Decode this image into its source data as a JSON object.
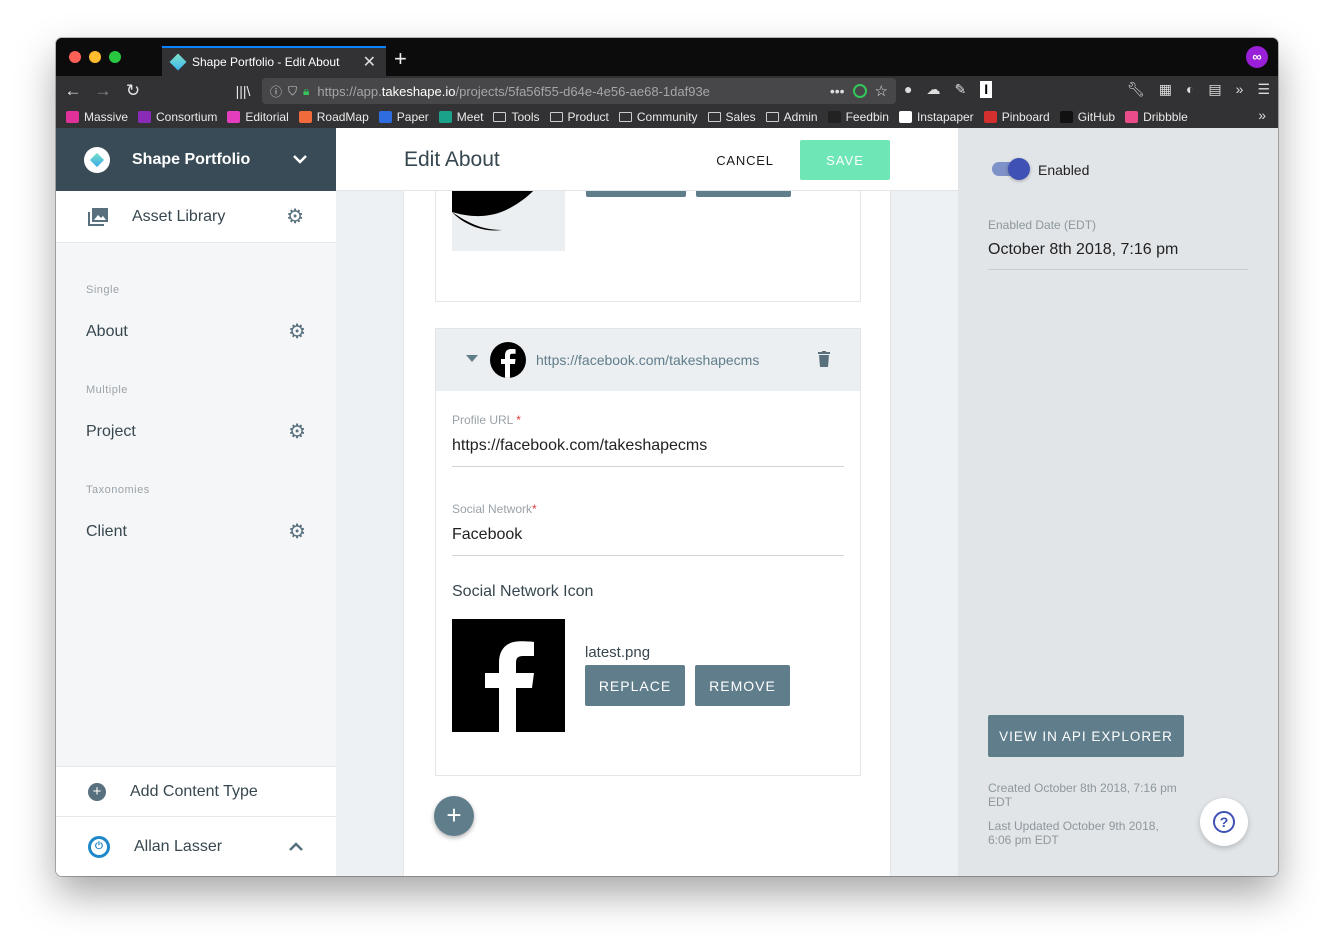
{
  "browser": {
    "tab_title": "Shape Portfolio - Edit About",
    "url_prefix": "https://app.",
    "url_domain": "takeshape.io",
    "url_path": "/projects/5fa56f55-d64e-4e56-ae68-1daf93e"
  },
  "bookmarks": [
    {
      "label": "Massive",
      "icon_color": "#e0309a"
    },
    {
      "label": "Consortium",
      "icon_color": "#8a2bb8"
    },
    {
      "label": "Editorial",
      "icon_color": "#e43dbd"
    },
    {
      "label": "RoadMap",
      "icon_color": "#f06a3b"
    },
    {
      "label": "Paper",
      "icon_color": "#2d6de0"
    },
    {
      "label": "Meet",
      "icon_color": "#1aa38a"
    },
    {
      "label": "Tools",
      "icon_color": "folder"
    },
    {
      "label": "Product",
      "icon_color": "folder"
    },
    {
      "label": "Community",
      "icon_color": "folder"
    },
    {
      "label": "Sales",
      "icon_color": "folder"
    },
    {
      "label": "Admin",
      "icon_color": "folder"
    },
    {
      "label": "Feedbin",
      "icon_color": "#222222"
    },
    {
      "label": "Instapaper",
      "icon_color": "#ffffff"
    },
    {
      "label": "Pinboard",
      "icon_color": "#d32f2f"
    },
    {
      "label": "GitHub",
      "icon_color": "#111111"
    },
    {
      "label": "Dribbble",
      "icon_color": "#ea4c89"
    }
  ],
  "sidebar": {
    "project_name": "Shape Portfolio",
    "asset_library": "Asset Library",
    "sections": {
      "single_label": "Single",
      "single_item": "About",
      "multiple_label": "Multiple",
      "multiple_item": "Project",
      "taxonomies_label": "Taxonomies",
      "taxonomies_item": "Client"
    },
    "add_content_type": "Add Content Type",
    "user_name": "Allan Lasser"
  },
  "main": {
    "title": "Edit About",
    "cancel_label": "CANCEL",
    "save_label": "SAVE",
    "replace_label": "REPLACE",
    "remove_label": "REMOVE",
    "facebook_card": {
      "header_url": "https://facebook.com/takeshapecms",
      "profile_url_label": "Profile URL",
      "profile_url_value": "https://facebook.com/takeshapecms",
      "social_network_label": "Social Network",
      "social_network_value": "Facebook",
      "icon_section_title": "Social Network Icon",
      "icon_filename": "latest.png",
      "required_mark": "*"
    }
  },
  "right_panel": {
    "enabled_label": "Enabled",
    "enabled": true,
    "enabled_date_label": "Enabled Date (EDT)",
    "enabled_date_value": "October 8th 2018, 7:16 pm",
    "api_explorer_label": "VIEW IN API EXPLORER",
    "created_text": "Created October 8th 2018, 7:16 pm EDT",
    "updated_text": "Last Updated October 9th 2018, 6:06 pm EDT",
    "help_symbol": "?"
  },
  "colors": {
    "sidebar_header": "#394b56",
    "save_button": "#6ee6b5",
    "slate_button": "#607d8b",
    "toggle": "#3f51b5"
  }
}
